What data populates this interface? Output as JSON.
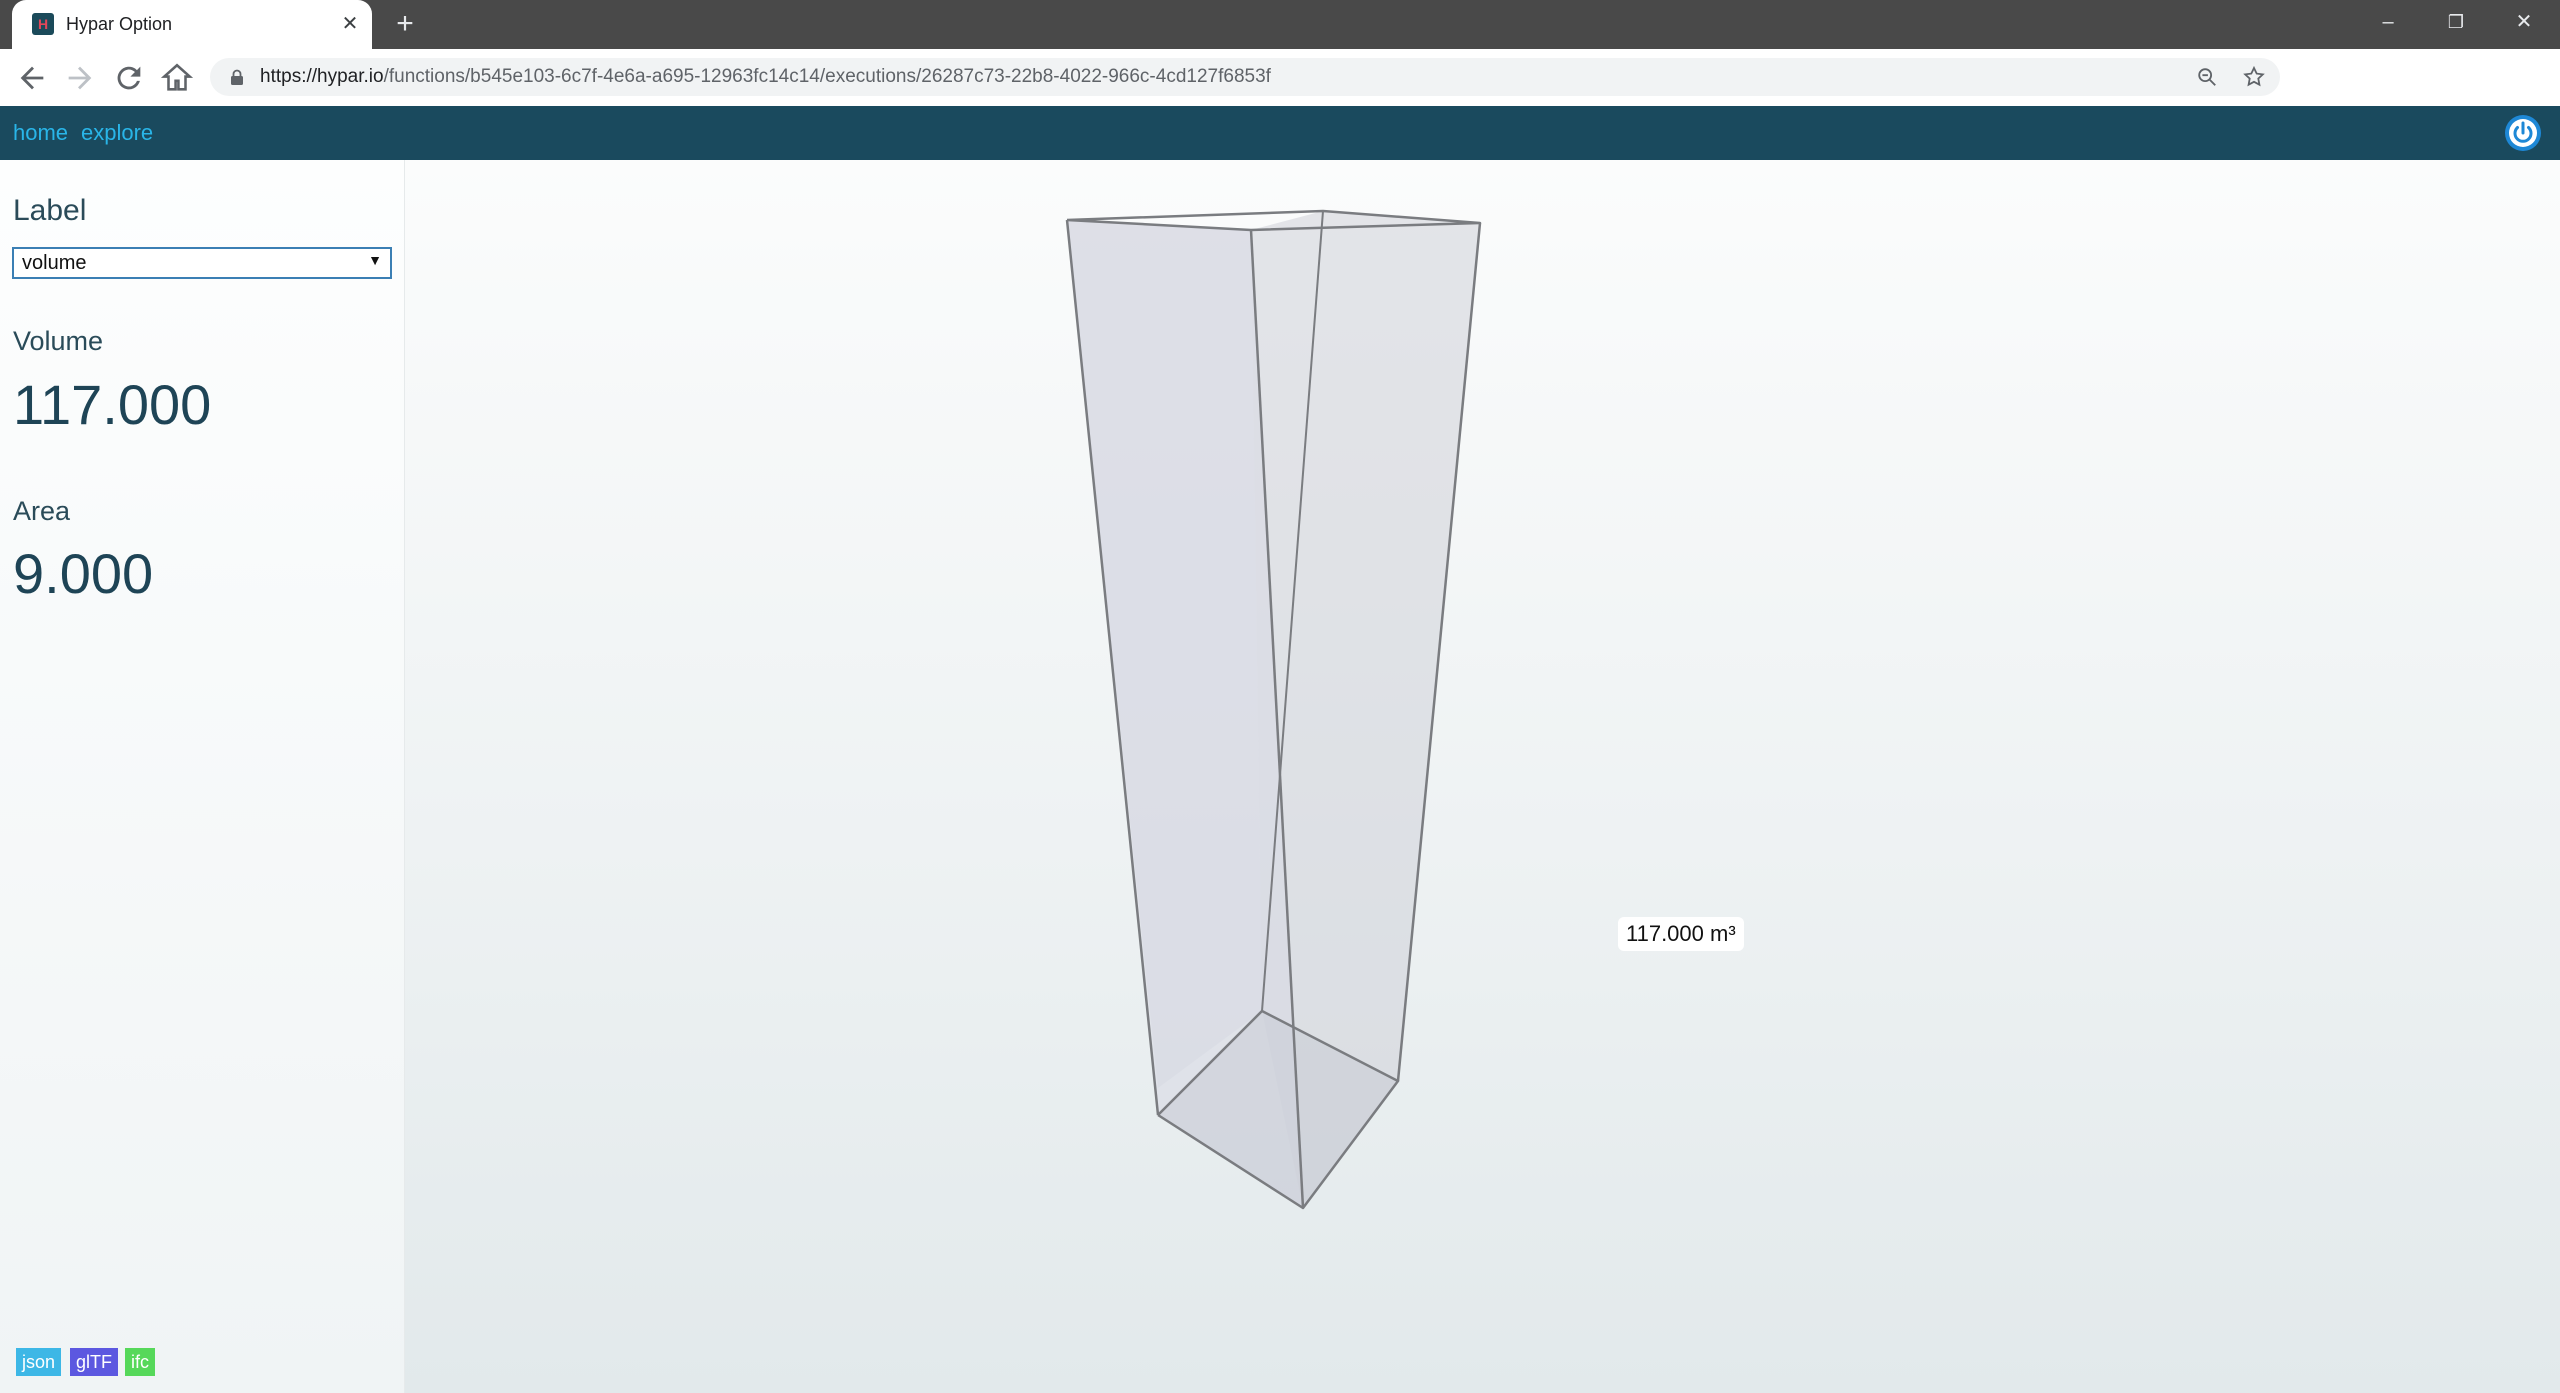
{
  "browser": {
    "tab_title": "Hypar Option",
    "favicon_letter": "H",
    "close_glyph": "✕",
    "new_tab_glyph": "+",
    "url_host": "https://hypar.io",
    "url_path": "/functions/b545e103-6c7f-4e6a-a695-12963fc14c14/executions/26287c73-22b8-4022-966c-4cd127f6853f",
    "window_controls": {
      "minimize": "–",
      "restore": "❐",
      "close": "✕"
    }
  },
  "nav": {
    "home": "home",
    "explore": "explore"
  },
  "sidebar": {
    "label_heading": "Label",
    "label_select_value": "volume",
    "volume_heading": "Volume",
    "volume_value": "117.000",
    "area_heading": "Area",
    "area_value": "9.000",
    "downloads": [
      "json",
      "glTF",
      "ifc"
    ]
  },
  "viewer": {
    "dimension_label": "117.000 m³"
  },
  "colors": {
    "app_header": "#1a4a5e",
    "link": "#29b5e8",
    "json_badge": "#3db7e6",
    "gltf_badge": "#5c58e0",
    "ifc_badge": "#56d85a"
  },
  "icons": [
    "back-icon",
    "forward-icon",
    "reload-icon",
    "home-icon",
    "lock-icon",
    "zoom-icon",
    "star-icon",
    "power-icon"
  ]
}
